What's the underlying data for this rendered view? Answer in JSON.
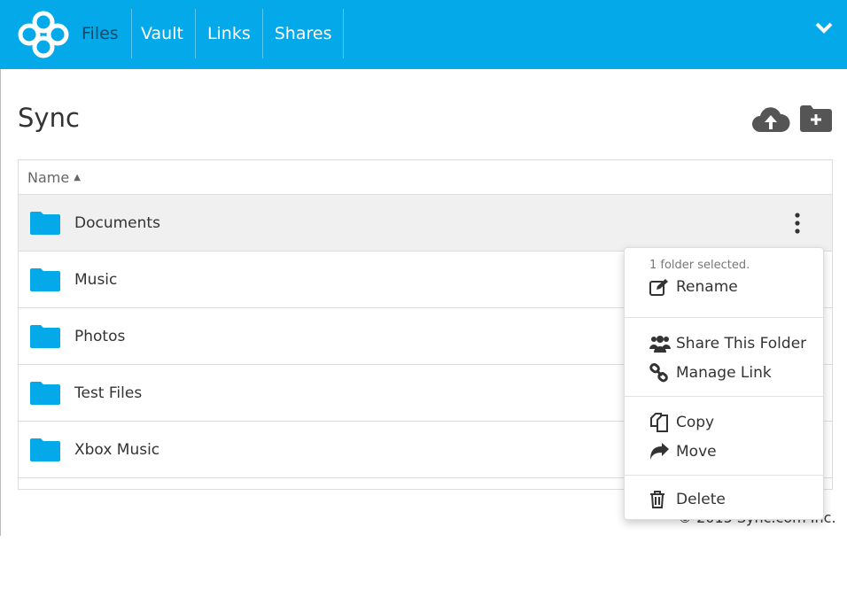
{
  "nav": {
    "items": [
      {
        "label": "Files",
        "active": true
      },
      {
        "label": "Vault"
      },
      {
        "label": "Links"
      },
      {
        "label": "Shares"
      }
    ]
  },
  "page": {
    "title": "Sync"
  },
  "table": {
    "name_header": "Name",
    "sort": "ascending",
    "rows": [
      {
        "name": "Documents",
        "selected": true
      },
      {
        "name": "Music"
      },
      {
        "name": "Photos"
      },
      {
        "name": "Test Files"
      },
      {
        "name": "Xbox Music"
      }
    ]
  },
  "menu": {
    "caption": "1 folder selected.",
    "rename": "Rename",
    "share": "Share This Folder",
    "manage_link": "Manage Link",
    "copy": "Copy",
    "move": "Move",
    "delete": "Delete"
  },
  "footer": "© 2015 Sync.com Inc.",
  "colors": {
    "brand": "#03a9e9",
    "folder": "#03a9e9"
  }
}
